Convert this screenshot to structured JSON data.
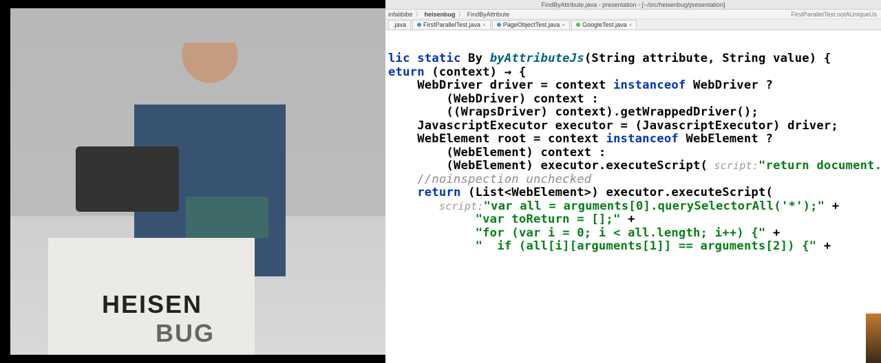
{
  "left": {
    "logo_line1": "HEISEN",
    "logo_line2": "BUG"
  },
  "ide": {
    "titlebar": "FindByAttribute.java - presentation - [~/src/heisenbug/presentation]",
    "breadcrumb": {
      "seg1": "infalibibe",
      "seg2": "heisenbug",
      "seg3": "FindByAttribute",
      "right_status": "FirstParallelTest.notAUniqueUs"
    },
    "tabs": [
      {
        "label": ".java"
      },
      {
        "label": "FirstParallelTest.java"
      },
      {
        "label": "PageObjectTest.java"
      },
      {
        "label": "GoogleTest.java"
      }
    ],
    "code": {
      "l1a": "lic ",
      "l1b": "static ",
      "l1c": "By ",
      "l1d": "byAttributeJs",
      "l1e": "(String attribute, String value) {",
      "l2a": "eturn ",
      "l2b": "(context) → {",
      "l3": "    WebDriver driver = context ",
      "l3b": "instanceof ",
      "l3c": "WebDriver ?",
      "l4": "        (WebDriver) context :",
      "l5": "        ((WrapsDriver) context).getWrappedDriver();",
      "l6": "    JavascriptExecutor executor = (JavascriptExecutor) driver;",
      "l7": "",
      "l8": "    WebElement root = context ",
      "l8b": "instanceof ",
      "l8c": "WebElement ?",
      "l9": "        (WebElement) context :",
      "l10a": "        (WebElement) executor.executeScript(",
      "l10h": " script:",
      "l10s": "\"return document.documen",
      "l11": "",
      "l12": "    //noinspection unchecked",
      "l13a": "    ",
      "l13b": "return ",
      "l13c": "(List<WebElement>) executor.executeScript(",
      "l14h": "        script:",
      "l14s": "\"var all = arguments[0].querySelectorAll('*');\"",
      "l14p": " +",
      "l15s": "            \"var toReturn = [];\"",
      "l15p": " +",
      "l16s": "            \"for (var i = 0; i < all.length; i++) {\"",
      "l16p": " +",
      "l17s": "            \"  if (all[i][arguments[1]] == arguments[2]) {\"",
      "l17p": " +"
    }
  }
}
